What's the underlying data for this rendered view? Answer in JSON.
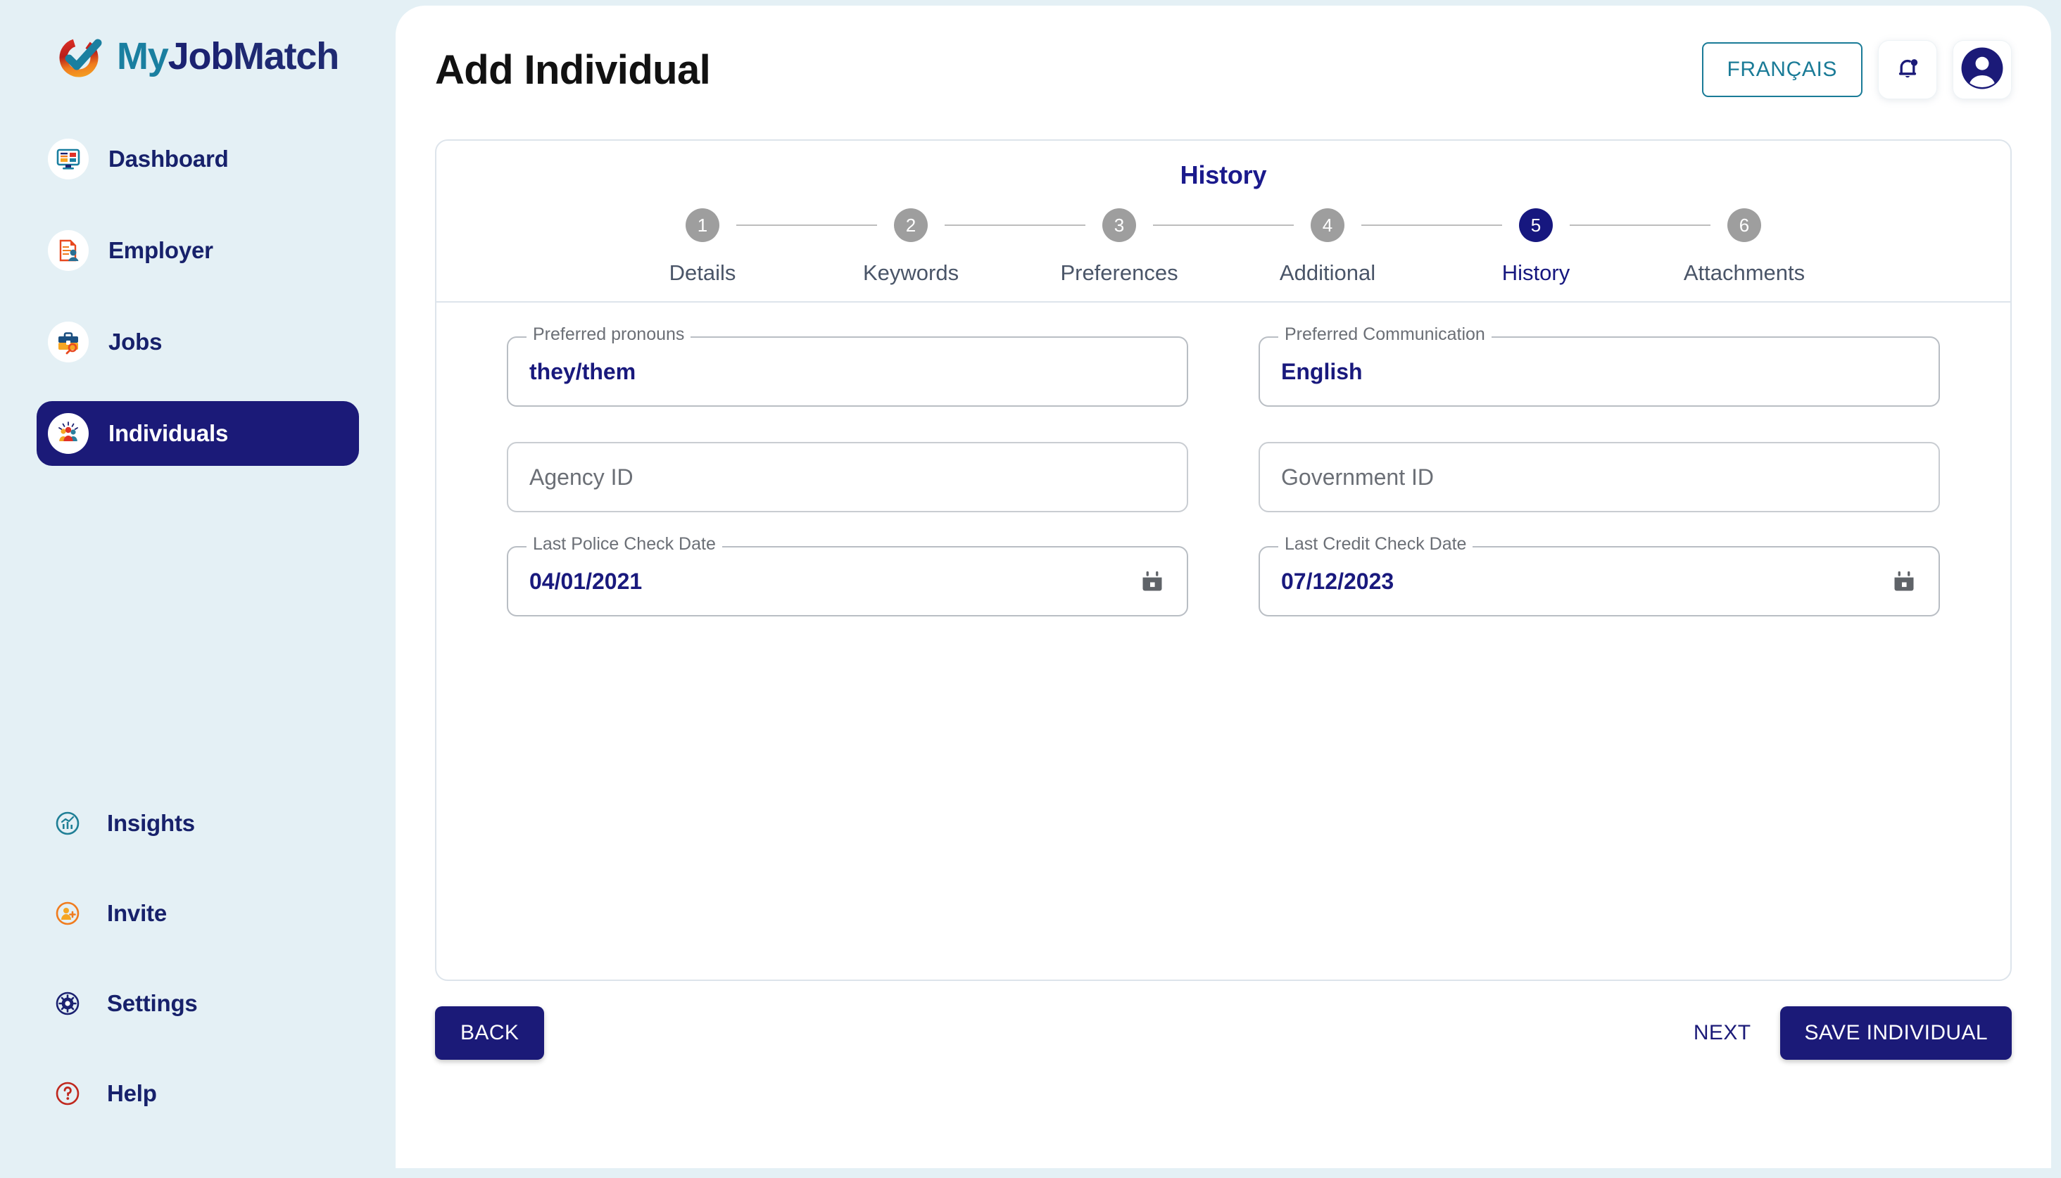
{
  "brand": {
    "name_my": "My",
    "name_job": "Job",
    "name_match": "Match",
    "logo_icon": "checkmark-ring-logo",
    "colors": {
      "teal": "#1a7fa0",
      "navy": "#1b2271",
      "orange": "#f07c1e",
      "red": "#d32a24"
    }
  },
  "sidebar": {
    "top_items": [
      {
        "label": "Dashboard",
        "icon": "monitor-dashboard-icon",
        "active": false
      },
      {
        "label": "Employer",
        "icon": "document-person-icon",
        "active": false
      },
      {
        "label": "Jobs",
        "icon": "briefcase-search-icon",
        "active": false
      },
      {
        "label": "Individuals",
        "icon": "group-people-icon",
        "active": true
      }
    ],
    "bottom_items": [
      {
        "label": "Insights",
        "icon": "chart-circle-icon",
        "active": false
      },
      {
        "label": "Invite",
        "icon": "person-add-icon",
        "active": false
      },
      {
        "label": "Settings",
        "icon": "gear-icon",
        "active": false
      },
      {
        "label": "Help",
        "icon": "question-mark-icon",
        "active": false
      }
    ]
  },
  "header": {
    "title": "Add Individual",
    "language_button": "FRANÇAIS",
    "notification_icon": "bell-icon",
    "notification_badge": true,
    "avatar_icon": "user-avatar-icon"
  },
  "wizard": {
    "current_step_title": "History",
    "steps": [
      {
        "number": "1",
        "label": "Details",
        "active": false
      },
      {
        "number": "2",
        "label": "Keywords",
        "active": false
      },
      {
        "number": "3",
        "label": "Preferences",
        "active": false
      },
      {
        "number": "4",
        "label": "Additional",
        "active": false
      },
      {
        "number": "5",
        "label": "History",
        "active": true
      },
      {
        "number": "6",
        "label": "Attachments",
        "active": false
      }
    ],
    "active_color": "#16177f",
    "inactive_color": "#9e9e9e"
  },
  "form": {
    "fields": [
      {
        "label": "Preferred pronouns",
        "value": "they/them",
        "placeholder": "",
        "filled": true,
        "has_calendar": false
      },
      {
        "label": "Preferred Communication",
        "value": "English",
        "placeholder": "",
        "filled": true,
        "has_calendar": false
      },
      {
        "label": "",
        "value": "",
        "placeholder": "Agency ID",
        "filled": false,
        "has_calendar": false
      },
      {
        "label": "",
        "value": "",
        "placeholder": "Government ID",
        "filled": false,
        "has_calendar": false
      },
      {
        "label": "Last Police Check Date",
        "value": "04/01/2021",
        "placeholder": "",
        "filled": true,
        "has_calendar": true
      },
      {
        "label": "Last Credit Check Date",
        "value": "07/12/2023",
        "placeholder": "",
        "filled": true,
        "has_calendar": true
      }
    ]
  },
  "footer": {
    "back_label": "BACK",
    "next_label": "NEXT",
    "save_label": "SAVE INDIVIDUAL"
  }
}
